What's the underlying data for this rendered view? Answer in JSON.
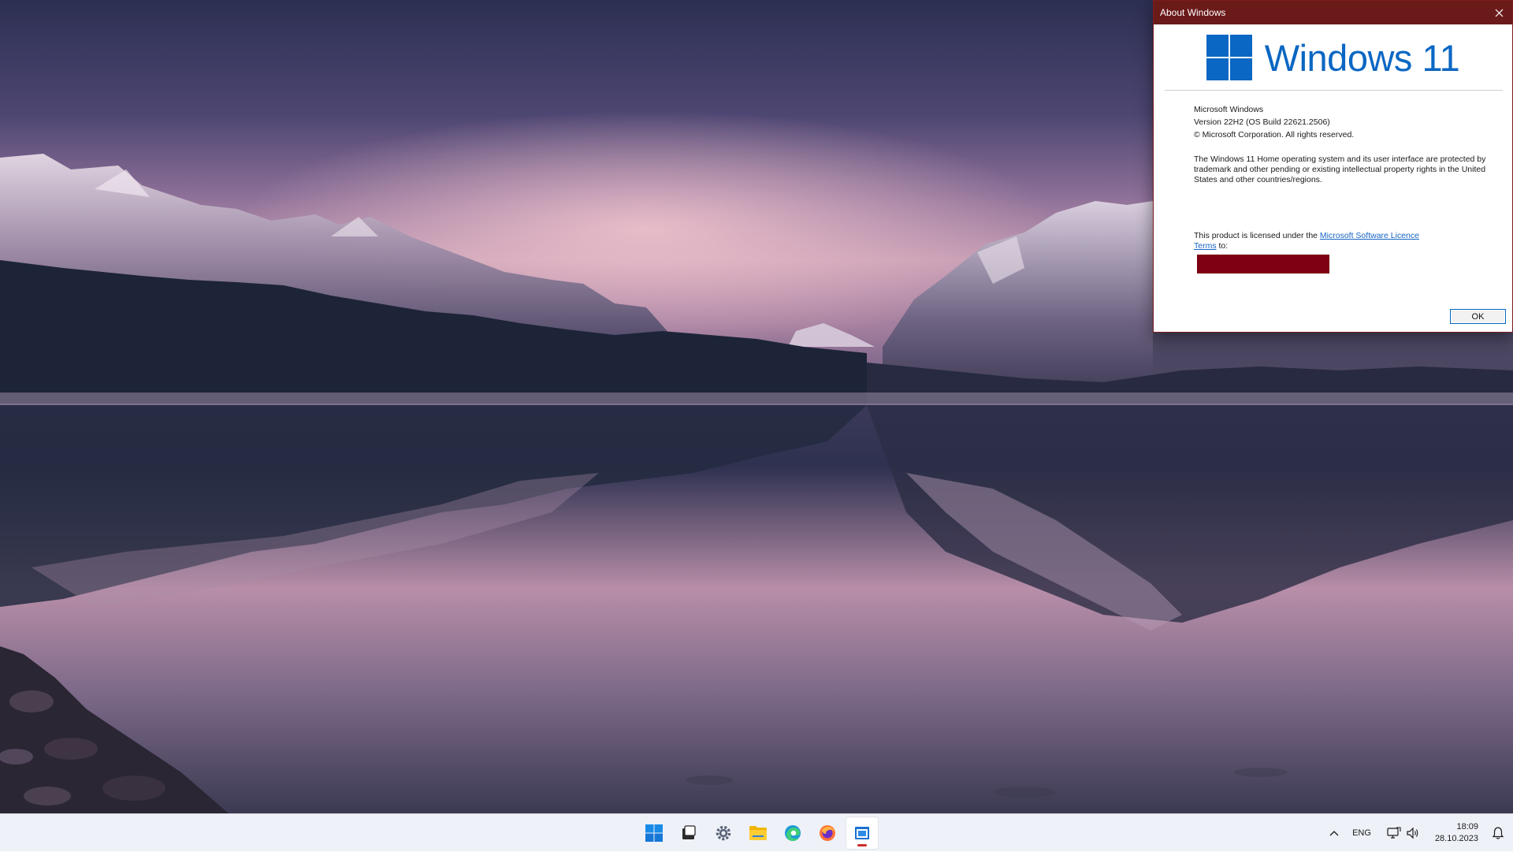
{
  "dialog": {
    "title": "About Windows",
    "logo_text": "Windows 11",
    "product_name": "Microsoft Windows",
    "version": "Version 22H2 (OS Build 22621.2506)",
    "copyright": "© Microsoft Corporation. All rights reserved.",
    "legal_text": "The Windows 11 Home operating system and its user interface are protected by trademark and other pending or existing intellectual property rights in the United States and other countries/regions.",
    "license_prefix": "This product is licensed under the ",
    "license_link": "Microsoft Software Licence Terms",
    "license_suffix": " to:",
    "ok_label": "OK",
    "accent_color": "#0a67c3",
    "titlebar_color": "#6b1a1a"
  },
  "taskbar": {
    "apps": [
      {
        "name": "start-button",
        "icon": "windows-logo-icon"
      },
      {
        "name": "task-view-button",
        "icon": "task-view-icon"
      },
      {
        "name": "settings-button",
        "icon": "gear-icon"
      },
      {
        "name": "file-explorer-button",
        "icon": "folder-icon"
      },
      {
        "name": "edge-button",
        "icon": "edge-icon"
      },
      {
        "name": "firefox-button",
        "icon": "firefox-icon"
      },
      {
        "name": "winver-button",
        "icon": "window-app-icon",
        "active": true
      }
    ],
    "tray": {
      "language": "ENG",
      "time": "18:09",
      "date": "28.10.2023"
    }
  }
}
